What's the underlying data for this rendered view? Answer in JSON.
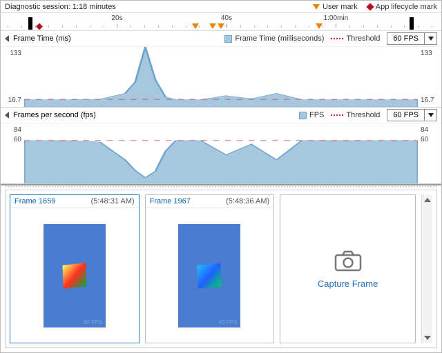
{
  "header": {
    "session_label": "Diagnostic session: 1:18 minutes",
    "user_mark_label": "User mark",
    "app_mark_label": "App lifecycle mark"
  },
  "timeline": {
    "labels": [
      "20s",
      "40s",
      "1:00min"
    ],
    "user_marks_pct": [
      44,
      48,
      50,
      73
    ],
    "app_marks_pct": [
      7.5
    ]
  },
  "panels": {
    "frame_time": {
      "title": "Frame Time (ms)",
      "legend_fill": "Frame Time (milliseconds)",
      "legend_thresh": "Threshold",
      "dropdown": "60 FPS",
      "y_top": "133",
      "y_bottom": "16.7"
    },
    "fps": {
      "title": "Frames per second (fps)",
      "legend_fill": "FPS",
      "legend_thresh": "Threshold",
      "dropdown": "60 FPS",
      "y_top": "84",
      "y_bottom": "60"
    }
  },
  "gallery": {
    "cards": [
      {
        "name": "Frame 1659",
        "time": "(5:48:31 AM)",
        "mini_fps": "60 FPS"
      },
      {
        "name": "Frame 1967",
        "time": "(5:48:36 AM)",
        "mini_fps": "60 FPS"
      }
    ],
    "capture_label": "Capture Frame"
  },
  "chart_data": [
    {
      "type": "area",
      "title": "Frame Time (ms)",
      "ylabel": "ms",
      "ylim": [
        0,
        133
      ],
      "threshold": 16.7,
      "x": [
        0,
        5,
        10,
        15,
        20,
        22,
        24,
        26,
        28,
        30,
        35,
        40,
        45,
        50,
        55,
        60,
        65,
        70,
        78
      ],
      "values": [
        16,
        16,
        16,
        17,
        30,
        55,
        133,
        60,
        22,
        16,
        16,
        25,
        18,
        30,
        16,
        16,
        16,
        16,
        16
      ]
    },
    {
      "type": "area",
      "title": "Frames per second (fps)",
      "ylabel": "fps",
      "ylim": [
        0,
        84
      ],
      "threshold": 60,
      "x": [
        0,
        5,
        10,
        15,
        20,
        22,
        24,
        26,
        28,
        30,
        35,
        40,
        45,
        50,
        55,
        60,
        65,
        70,
        78
      ],
      "values": [
        60,
        60,
        60,
        58,
        33,
        18,
        8,
        17,
        45,
        60,
        60,
        40,
        55,
        33,
        60,
        60,
        60,
        60,
        60
      ]
    }
  ]
}
